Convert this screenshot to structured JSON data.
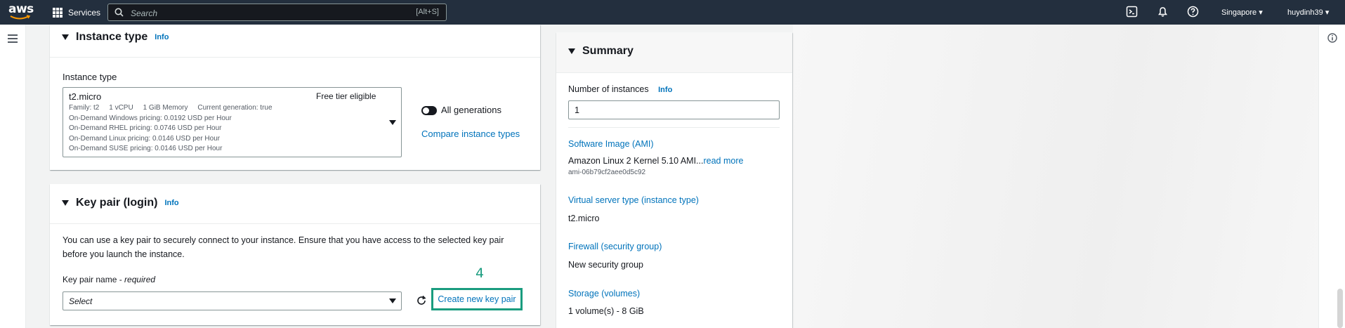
{
  "topnav": {
    "logo": "aws",
    "services": "Services",
    "search_placeholder": "Search",
    "search_shortcut": "[Alt+S]",
    "region": "Singapore ▾",
    "user": "huydinh39 ▾"
  },
  "instance_type": {
    "title": "Instance type",
    "info": "Info",
    "field_label": "Instance type",
    "name": "t2.micro",
    "free_tier": "Free tier eligible",
    "specs": "Family: t2     1 vCPU     1 GiB Memory     Current generation: true",
    "pricing": [
      "On-Demand Windows pricing: 0.0192 USD per Hour",
      "On-Demand RHEL pricing: 0.0746 USD per Hour",
      "On-Demand Linux pricing: 0.0146 USD per Hour",
      "On-Demand SUSE pricing: 0.0146 USD per Hour"
    ],
    "toggle_label": "All generations",
    "compare_link": "Compare instance types"
  },
  "key_pair": {
    "title": "Key pair (login)",
    "info": "Info",
    "description": "You can use a key pair to securely connect to your instance. Ensure that you have access to the selected key pair before you launch the instance.",
    "field_label": "Key pair name - ",
    "field_required": "required",
    "select_placeholder": "Select",
    "create_button": "Create new key pair",
    "step_number": "4"
  },
  "summary": {
    "title": "Summary",
    "instances_label": "Number of instances",
    "info": "Info",
    "instances_value": "1",
    "ami_label": "Software Image (AMI)",
    "ami_value": "Amazon Linux 2 Kernel 5.10 AMI...",
    "ami_read_more": "read more",
    "ami_id": "ami-06b79cf2aee0d5c92",
    "server_type_label": "Virtual server type (instance type)",
    "server_type_value": "t2.micro",
    "firewall_label": "Firewall (security group)",
    "firewall_value": "New security group",
    "storage_label": "Storage (volumes)",
    "storage_value": "1 volume(s) - 8 GiB"
  },
  "colors": {
    "nav_bg": "#232f3e",
    "link": "#0073bb",
    "highlight": "#1a9c7f"
  }
}
